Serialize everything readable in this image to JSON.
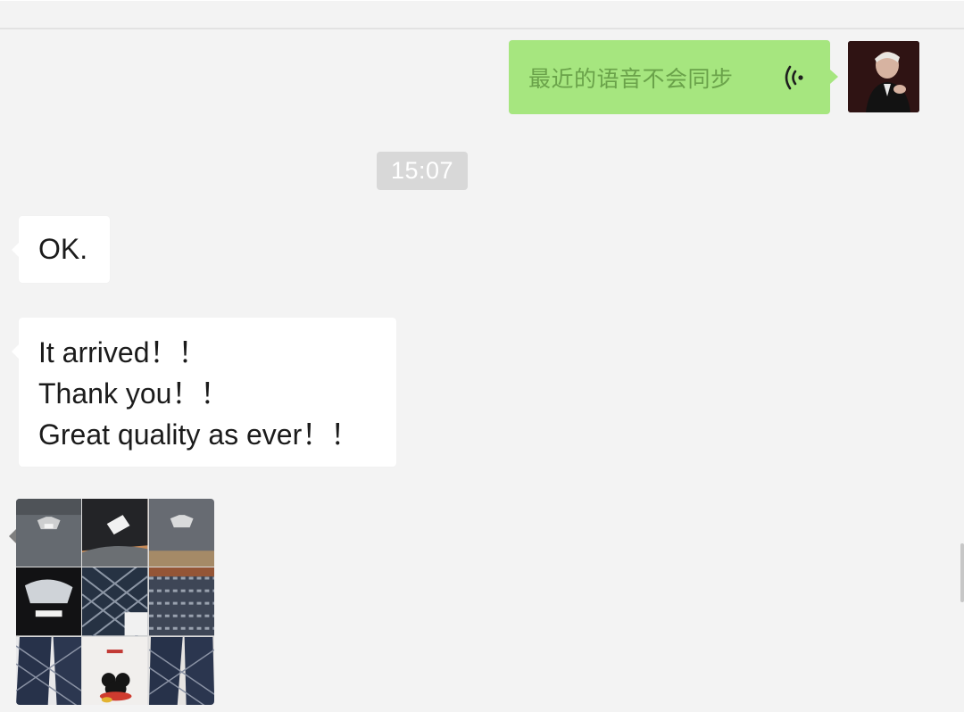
{
  "messages": {
    "voice": {
      "text": "最近的语音不会同步",
      "icon": "voice-wave-icon",
      "bubble_color": "#a6e67f",
      "text_color": "#6aa24a"
    },
    "timestamp": "15:07",
    "ok": {
      "text": "OK."
    },
    "arrived": {
      "lines": [
        "It arrived！！",
        "Thank you！！",
        "Great quality as ever！！"
      ]
    },
    "photo_grid": {
      "rows": 3,
      "cols": 3,
      "items": [
        "grey-tshirt-photo",
        "cap-photo",
        "grey-tshirt-photo",
        "black-tshirt-photo",
        "patterned-jacket-photo",
        "patterned-shirt-photo",
        "patterned-pants-photo",
        "mickey-tshirt-photo",
        "patterned-pants-photo"
      ]
    }
  },
  "theme": {
    "background": "#f3f3f3",
    "incoming_bubble": "#ffffff",
    "time_badge": "#d8d8d8"
  }
}
